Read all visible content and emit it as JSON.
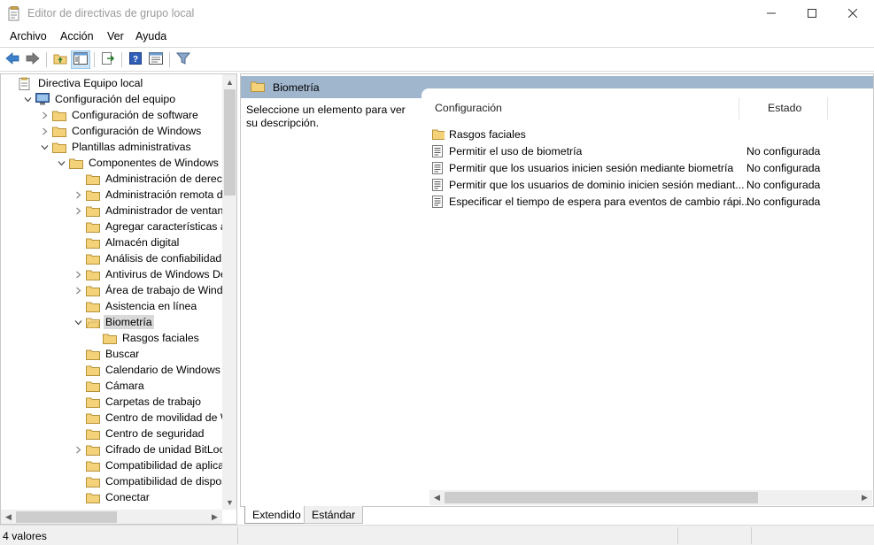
{
  "window": {
    "title": "Editor de directivas de grupo local",
    "min_icon": "minimize-icon",
    "max_icon": "maximize-icon",
    "close_icon": "close-icon"
  },
  "menu": {
    "items": [
      "Archivo",
      "Acción",
      "Ver",
      "Ayuda"
    ]
  },
  "toolbar": {
    "buttons": [
      "back-arrow-icon",
      "forward-arrow-icon",
      "up-folder-icon",
      "show-hide-tree-icon",
      "export-list-icon",
      "help-icon",
      "properties-icon",
      "filter-icon"
    ]
  },
  "tree": {
    "rows": [
      {
        "label": "Directiva Equipo local",
        "icon": "policy-doc-icon",
        "expander": "none"
      },
      {
        "label": "Configuración del equipo",
        "icon": "computer-icon",
        "expander": "expanded"
      },
      {
        "label": "Configuración de software",
        "icon": "folder-icon",
        "expander": "collapsed"
      },
      {
        "label": "Configuración de Windows",
        "icon": "folder-icon",
        "expander": "collapsed"
      },
      {
        "label": "Plantillas administrativas",
        "icon": "folder-icon",
        "expander": "expanded"
      },
      {
        "label": "Componentes de Windows",
        "icon": "folder-icon",
        "expander": "expanded"
      },
      {
        "label": "Administración de derechos",
        "icon": "folder-icon",
        "expander": "none"
      },
      {
        "label": "Administración remota de W",
        "icon": "folder-icon",
        "expander": "collapsed"
      },
      {
        "label": "Administrador de ventanas",
        "icon": "folder-icon",
        "expander": "collapsed"
      },
      {
        "label": "Agregar características a Wi",
        "icon": "folder-icon",
        "expander": "none"
      },
      {
        "label": "Almacén digital",
        "icon": "folder-icon",
        "expander": "none"
      },
      {
        "label": "Análisis de confiabilidad de",
        "icon": "folder-icon",
        "expander": "none"
      },
      {
        "label": "Antivirus de Windows Defer",
        "icon": "folder-icon",
        "expander": "collapsed"
      },
      {
        "label": "Área de trabajo de Windows",
        "icon": "folder-icon",
        "expander": "collapsed"
      },
      {
        "label": "Asistencia en línea",
        "icon": "folder-icon",
        "expander": "none"
      },
      {
        "label": "Biometría",
        "icon": "folder-open-icon",
        "expander": "expanded",
        "selected": true
      },
      {
        "label": "Rasgos faciales",
        "icon": "folder-icon",
        "expander": "none"
      },
      {
        "label": "Buscar",
        "icon": "folder-icon",
        "expander": "none"
      },
      {
        "label": "Calendario de Windows",
        "icon": "folder-icon",
        "expander": "none"
      },
      {
        "label": "Cámara",
        "icon": "folder-icon",
        "expander": "none"
      },
      {
        "label": "Carpetas de trabajo",
        "icon": "folder-icon",
        "expander": "none"
      },
      {
        "label": "Centro de movilidad de Win",
        "icon": "folder-icon",
        "expander": "none"
      },
      {
        "label": "Centro de seguridad",
        "icon": "folder-icon",
        "expander": "none"
      },
      {
        "label": "Cifrado de unidad BitLocker",
        "icon": "folder-icon",
        "expander": "collapsed"
      },
      {
        "label": "Compatibilidad de aplicacio",
        "icon": "folder-icon",
        "expander": "none"
      },
      {
        "label": "Compatibilidad de dispositiv",
        "icon": "folder-icon",
        "expander": "none"
      },
      {
        "label": "Conectar",
        "icon": "folder-icon",
        "expander": "none"
      }
    ]
  },
  "right": {
    "header": "Biometría",
    "description": "Seleccione un elemento para ver su descripción.",
    "columns": {
      "setting": "Configuración",
      "state": "Estado"
    },
    "rows": [
      {
        "name": "Rasgos faciales",
        "icon": "folder-icon",
        "state": ""
      },
      {
        "name": "Permitir el uso de biometría",
        "icon": "policy-setting-icon",
        "state": "No configurada"
      },
      {
        "name": "Permitir que los usuarios inicien sesión mediante biometría",
        "icon": "policy-setting-icon",
        "state": "No configurada"
      },
      {
        "name": "Permitir que los usuarios de dominio inicien sesión mediant...",
        "icon": "policy-setting-icon",
        "state": "No configurada"
      },
      {
        "name": "Especificar el tiempo de espera para eventos de cambio rápi...",
        "icon": "policy-setting-icon",
        "state": "No configurada"
      }
    ]
  },
  "tabs": {
    "extended": "Extendido",
    "standard": "Estándar"
  },
  "status": {
    "text": "4 valores"
  },
  "colors": {
    "header_band": "#9fb6cd",
    "folder_yellow": "#f4d27a",
    "selection_gray": "#d9d9d9"
  }
}
